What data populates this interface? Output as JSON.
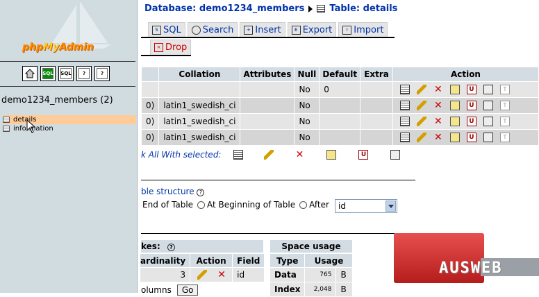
{
  "left": {
    "logo_php": "php",
    "logo_my": "My",
    "logo_admin": "Admin",
    "db_name": "demo1234_members (2)",
    "tables": [
      {
        "label": "details",
        "selected": true
      },
      {
        "label": "information",
        "selected": false
      }
    ],
    "nav_icons": [
      "home-icon",
      "sql-query-icon",
      "sql-icon",
      "docs-icon",
      "help-icon"
    ]
  },
  "breadcrumb": {
    "database": "Database: demo1234_members",
    "table": "Table: details"
  },
  "tabs_row1": [
    "SQL",
    "Search",
    "Insert",
    "Export",
    "Import"
  ],
  "tabs_row2": [
    "Drop"
  ],
  "structure": {
    "headers": [
      "Collation",
      "Attributes",
      "Null",
      "Default",
      "Extra",
      "Action"
    ],
    "rows": [
      {
        "prefix": "",
        "collation": "",
        "attributes": "",
        "null": "No",
        "default": "0",
        "extra": ""
      },
      {
        "prefix": "0)",
        "collation": "latin1_swedish_ci",
        "attributes": "",
        "null": "No",
        "default": "",
        "extra": ""
      },
      {
        "prefix": "0)",
        "collation": "latin1_swedish_ci",
        "attributes": "",
        "null": "No",
        "default": "",
        "extra": ""
      },
      {
        "prefix": "0)",
        "collation": "latin1_swedish_ci",
        "attributes": "",
        "null": "No",
        "default": "",
        "extra": ""
      }
    ],
    "with_selected": "k All With selected:"
  },
  "add_field": {
    "title": "ble structure",
    "end": "End of Table",
    "begin": "At Beginning of Table",
    "after": "After",
    "after_value": "id"
  },
  "indexes": {
    "title": "kes:",
    "headers": [
      "ardinality",
      "Action",
      "Field"
    ],
    "row": {
      "cardinality": "3",
      "field": "id"
    },
    "columns_label": "olumns",
    "go": "Go"
  },
  "space": {
    "title": "Space usage",
    "headers": [
      "Type",
      "Usage"
    ],
    "rows": [
      {
        "type": "Data",
        "usage": "765",
        "unit": "B"
      },
      {
        "type": "Index",
        "usage": "2,048",
        "unit": "B"
      }
    ]
  },
  "brand": "AUSWEB",
  "colors": {
    "link": "#0033aa",
    "header_bg": "#d3dce3",
    "selected_row": "#ffcc99",
    "brand_red": "#cc2a2a"
  }
}
